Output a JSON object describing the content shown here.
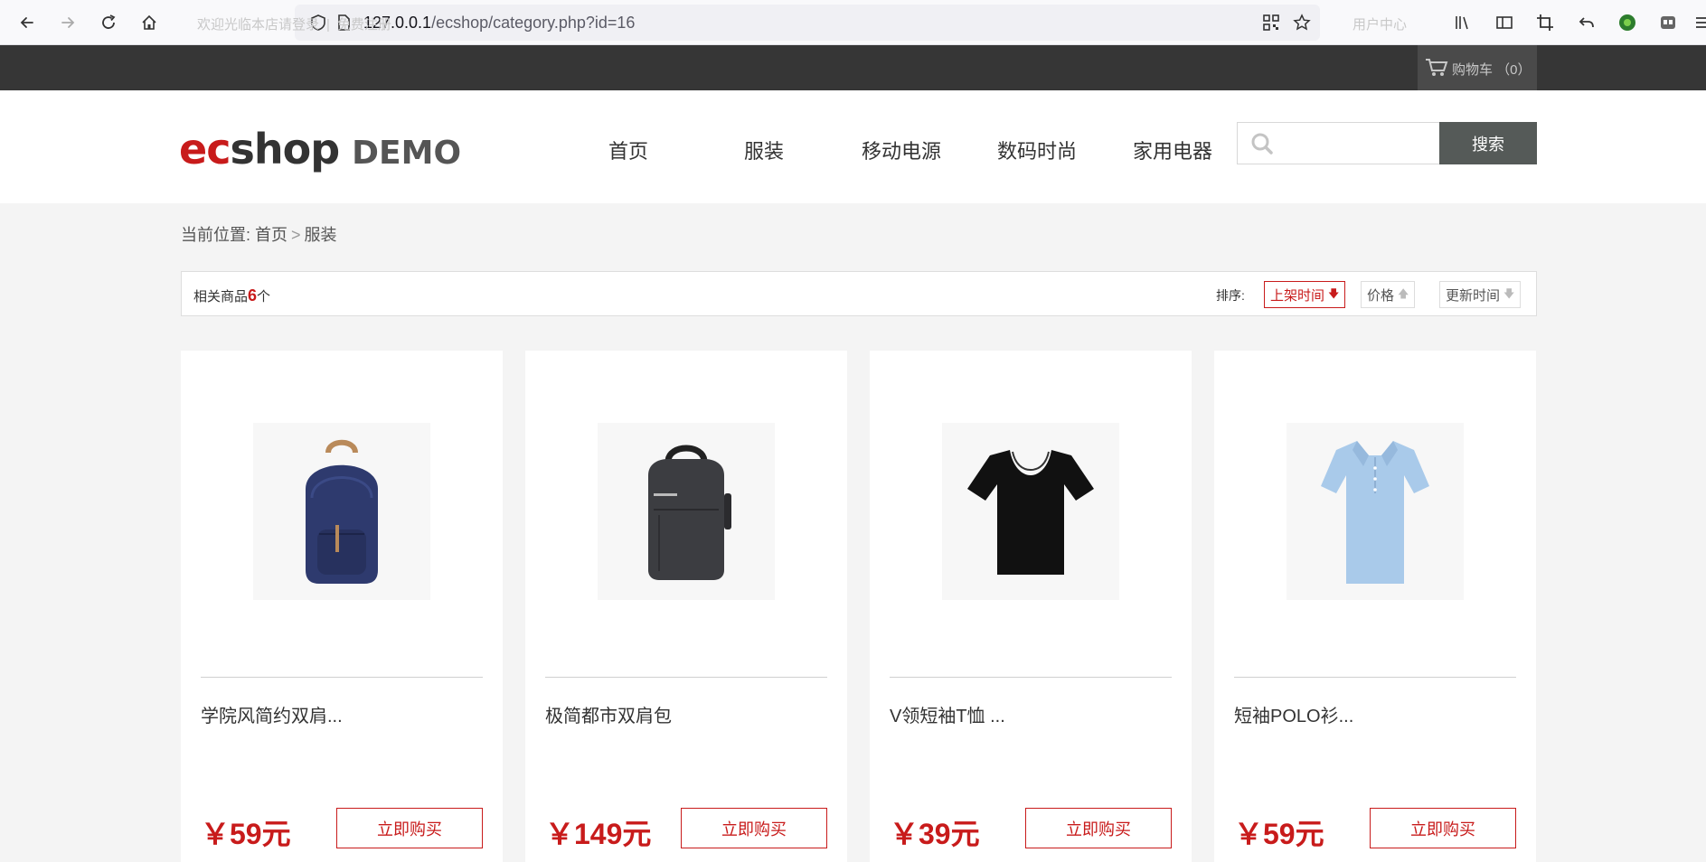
{
  "browser": {
    "url_host": "127.0.0.1",
    "url_path": "/ecshop/category.php?id=16"
  },
  "topbar": {
    "login_text": "欢迎光临本店请登录",
    "separator": "|",
    "register_text": "免费注册",
    "user_center": "用户中心",
    "cart_label": "购物车 （0）"
  },
  "header": {
    "logo_ec": "ec",
    "logo_shop": "shop",
    "logo_demo": "DEMO",
    "nav": [
      "首页",
      "服装",
      "移动电源",
      "数码时尚",
      "家用电器"
    ],
    "search_placeholder": "",
    "search_button": "搜索"
  },
  "breadcrumb": {
    "prefix": "当前位置:",
    "home": "首页",
    "arrow": ">",
    "current": "服装"
  },
  "filter": {
    "count_prefix": "相关商品",
    "count": "6",
    "count_suffix": "个",
    "sort_label": "排序:",
    "sort_options": [
      {
        "label": "上架时间",
        "arrow": "🡇"
      },
      {
        "label": "价格",
        "arrow": "🡅"
      },
      {
        "label": "更新时间",
        "arrow": "🡇"
      }
    ]
  },
  "products": [
    {
      "name": "学院风简约双肩...",
      "price": "￥59元",
      "buy": "立即购买",
      "image": "backpack-blue"
    },
    {
      "name": "极简都市双肩包",
      "price": "￥149元",
      "buy": "立即购买",
      "image": "backpack-gray"
    },
    {
      "name": "V领短袖T恤 ...",
      "price": "￥39元",
      "buy": "立即购买",
      "image": "tshirt-black"
    },
    {
      "name": "短袖POLO衫...",
      "price": "￥59元",
      "buy": "立即购买",
      "image": "polo-lightblue"
    }
  ],
  "colors": {
    "accent_red": "#c81b1b",
    "topbar_bg": "#363636",
    "search_btn_bg": "#555a58"
  }
}
